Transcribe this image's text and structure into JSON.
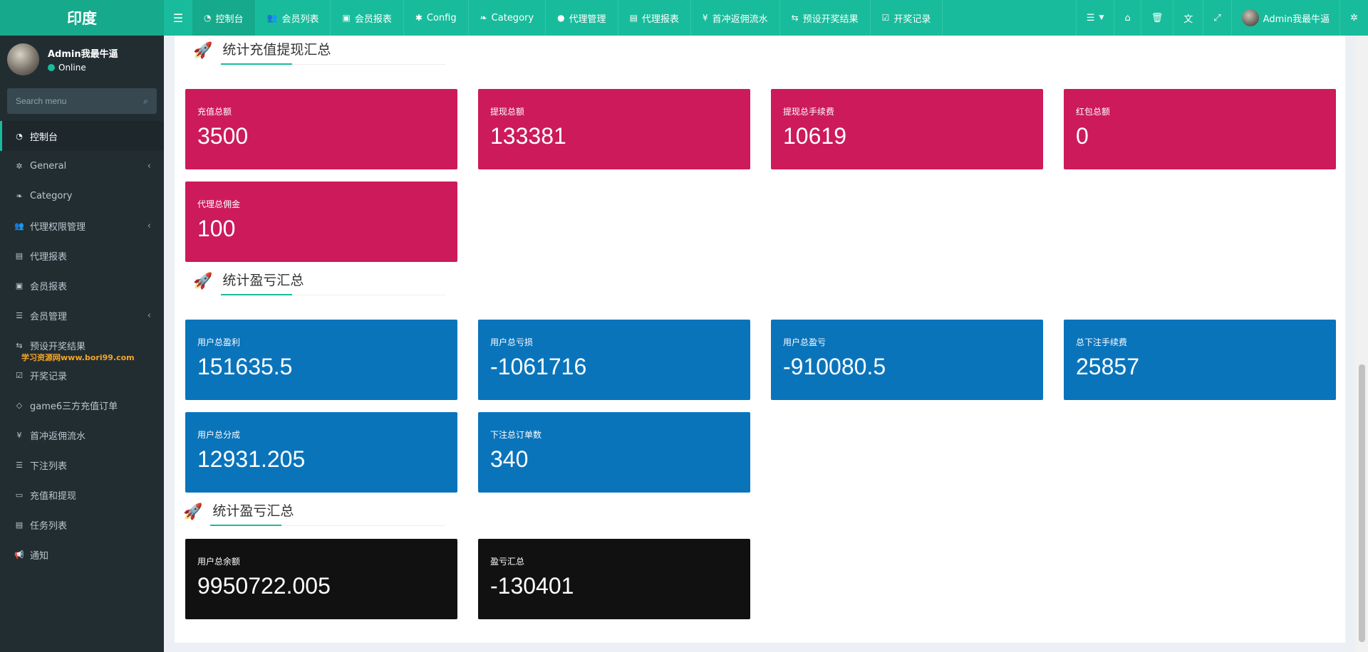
{
  "brand": "印度",
  "nav": [
    {
      "label": "控制台",
      "icon": "dashboard-icon",
      "glyph": "◔",
      "active": true
    },
    {
      "label": "会员列表",
      "icon": "users-icon",
      "glyph": "👥",
      "active": false
    },
    {
      "label": "会员报表",
      "icon": "address-book-icon",
      "glyph": "▣",
      "active": false
    },
    {
      "label": "Config",
      "icon": "gear-icon",
      "glyph": "✱",
      "active": false
    },
    {
      "label": "Category",
      "icon": "leaf-icon",
      "glyph": "❧",
      "active": false
    },
    {
      "label": "代理管理",
      "icon": "user-icon",
      "glyph": "●",
      "active": false
    },
    {
      "label": "代理报表",
      "icon": "book-icon",
      "glyph": "▤",
      "active": false
    },
    {
      "label": "首冲返佣流水",
      "icon": "yen-icon",
      "glyph": "¥",
      "active": false
    },
    {
      "label": "预设开奖结果",
      "icon": "random-icon",
      "glyph": "⇆",
      "active": false
    },
    {
      "label": "开奖记录",
      "icon": "calendar-check-icon",
      "glyph": "☑",
      "active": false
    }
  ],
  "topright": {
    "username": "Admin我最牛逼"
  },
  "user": {
    "name": "Admin我最牛逼",
    "status": "Online"
  },
  "search": {
    "placeholder": "Search menu"
  },
  "menu": [
    {
      "label": "控制台",
      "icon": "dashboard-icon",
      "glyph": "◔",
      "active": true,
      "chevron": false
    },
    {
      "label": "General",
      "icon": "cogs-icon",
      "glyph": "✲",
      "active": false,
      "chevron": true
    },
    {
      "label": "Category",
      "icon": "leaf-icon",
      "glyph": "❧",
      "active": false,
      "chevron": false
    },
    {
      "label": "代理权限管理",
      "icon": "users-icon",
      "glyph": "👥",
      "active": false,
      "chevron": true
    },
    {
      "label": "代理报表",
      "icon": "book-icon",
      "glyph": "▤",
      "active": false,
      "chevron": false
    },
    {
      "label": "会员报表",
      "icon": "address-book-icon",
      "glyph": "▣",
      "active": false,
      "chevron": false
    },
    {
      "label": "会员管理",
      "icon": "list-icon",
      "glyph": "☰",
      "active": false,
      "chevron": true
    },
    {
      "label": "预设开奖结果",
      "icon": "random-icon",
      "glyph": "⇆",
      "active": false,
      "chevron": false
    },
    {
      "label": "开奖记录",
      "icon": "calendar-check-icon",
      "glyph": "☑",
      "active": false,
      "chevron": false
    },
    {
      "label": "game6三方充值订单",
      "icon": "diamond-icon",
      "glyph": "◇",
      "active": false,
      "chevron": false
    },
    {
      "label": "首冲返佣流水",
      "icon": "yen-icon",
      "glyph": "¥",
      "active": false,
      "chevron": false
    },
    {
      "label": "下注列表",
      "icon": "list-icon",
      "glyph": "☰",
      "active": false,
      "chevron": false
    },
    {
      "label": "充值和提现",
      "icon": "money-icon",
      "glyph": "▭",
      "active": false,
      "chevron": false
    },
    {
      "label": "任务列表",
      "icon": "book-icon",
      "glyph": "▤",
      "active": false,
      "chevron": false
    },
    {
      "label": "通知",
      "icon": "bullhorn-icon",
      "glyph": "📢",
      "active": false,
      "chevron": false
    }
  ],
  "watermark": "学习资源网www.bori99.com",
  "sections": [
    {
      "title": "统计充值提现汇总",
      "cards": [
        {
          "label": "充值总额",
          "value": "3500"
        },
        {
          "label": "提现总额",
          "value": "133381"
        },
        {
          "label": "提现总手续费",
          "value": "10619"
        },
        {
          "label": "红包总额",
          "value": "0"
        },
        {
          "label": "代理总佣金",
          "value": "100"
        }
      ]
    },
    {
      "title": "统计盈亏汇总",
      "cards": [
        {
          "label": "用户总盈利",
          "value": "151635.5"
        },
        {
          "label": "用户总亏损",
          "value": "-1061716"
        },
        {
          "label": "用户总盈亏",
          "value": "-910080.5"
        },
        {
          "label": "总下注手续费",
          "value": "25857"
        },
        {
          "label": "用户总分成",
          "value": "12931.205"
        },
        {
          "label": "下注总订单数",
          "value": "340"
        }
      ]
    },
    {
      "title": "统计盈亏汇总",
      "cards": [
        {
          "label": "用户总余额",
          "value": "9950722.005"
        },
        {
          "label": "盈亏汇总",
          "value": "-130401"
        }
      ]
    }
  ],
  "colors": {
    "primary": "#18bc9c",
    "sidebar": "#222d32",
    "card_pink": "#cc1a5a",
    "card_blue": "#0a74bb",
    "card_black": "#111111"
  }
}
